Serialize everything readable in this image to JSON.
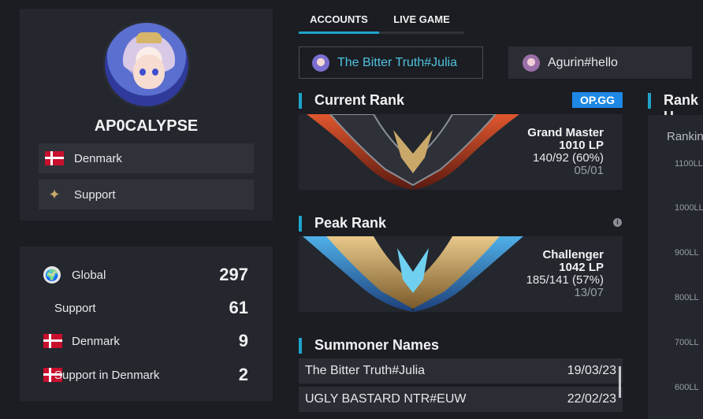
{
  "profile": {
    "name": "AP0CALYPSE",
    "country": "Denmark",
    "role": "Support"
  },
  "rankings": [
    {
      "label": "Global",
      "value": "297",
      "icon": "globe-icon"
    },
    {
      "label": "Support",
      "value": "61",
      "icon": "none"
    },
    {
      "label": "Denmark",
      "value": "9",
      "icon": "denmark-flag-icon"
    },
    {
      "label": "Support in Denmark",
      "value": "2",
      "icon": "denmark-flag-icon"
    }
  ],
  "tabs": {
    "accounts": "ACCOUNTS",
    "live_game": "LIVE GAME",
    "active": "ACCOUNTS"
  },
  "accounts": [
    {
      "name": "The Bitter Truth#Julia",
      "selected": true
    },
    {
      "name": "Agurin#hello",
      "selected": false
    }
  ],
  "current_rank": {
    "title": "Current Rank",
    "badge": "OP.GG",
    "tier": "Grand Master",
    "lp": "1010 LP",
    "record": "140/92 (60%)",
    "date": "05/01"
  },
  "peak_rank": {
    "title": "Peak Rank",
    "info": "i",
    "tier": "Challenger",
    "lp": "1042 LP",
    "record": "185/141 (57%)",
    "date": "13/07"
  },
  "summoner_names": {
    "title": "Summoner Names",
    "rows": [
      {
        "name": "The Bitter Truth#Julia",
        "date": "19/03/23"
      },
      {
        "name": "UGLY BASTARD NTR#EUW",
        "date": "22/02/23"
      }
    ]
  },
  "rank_history": {
    "title": "Rank H",
    "label": "Rankin",
    "ticks": [
      "1100LL",
      "1000LL",
      "900LL",
      "800LL",
      "700LL",
      "600LL"
    ]
  },
  "colors": {
    "accent": "#1fa3c9",
    "opgg": "#1e88e5",
    "link": "#4fc3e0"
  }
}
